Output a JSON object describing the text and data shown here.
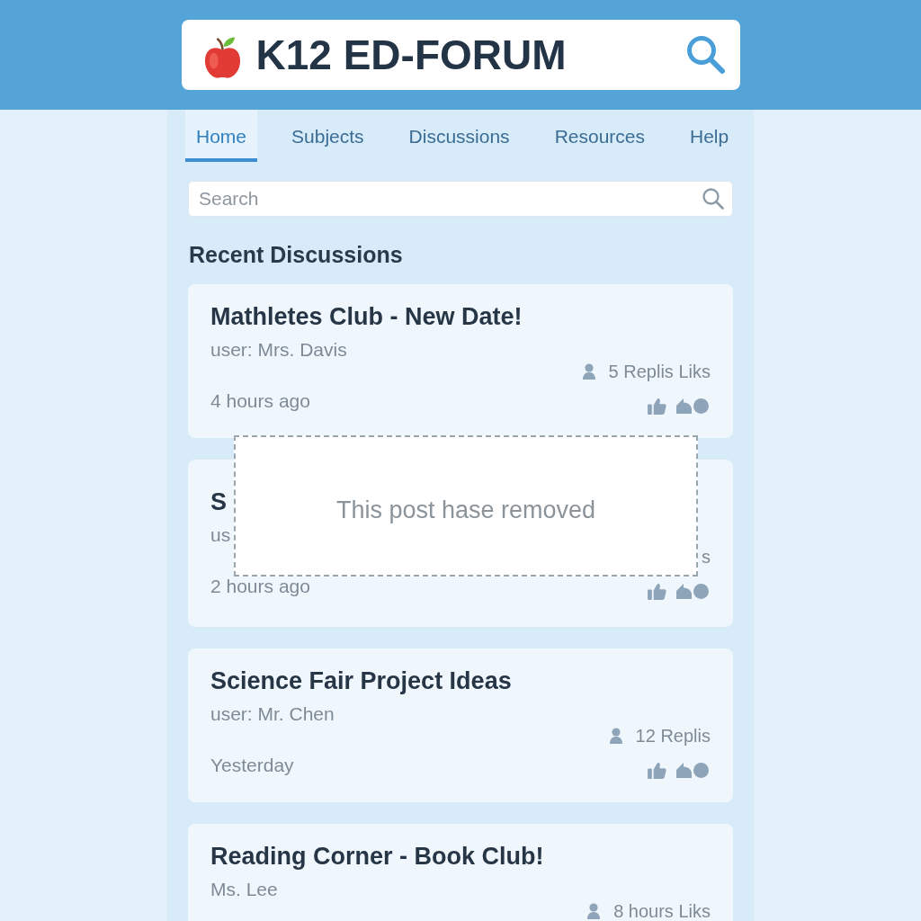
{
  "header": {
    "title": "K12 ED-FORUM"
  },
  "nav": {
    "tabs": [
      {
        "label": "Home",
        "selected": true
      },
      {
        "label": "Subjects",
        "selected": false
      },
      {
        "label": "Discussions",
        "selected": false
      },
      {
        "label": "Resources",
        "selected": false
      },
      {
        "label": "Help",
        "selected": false
      }
    ]
  },
  "search": {
    "placeholder": "Search"
  },
  "section_title": "Recent Discussions",
  "posts": [
    {
      "title": "Mathletes Club - New Date!",
      "author": "user: Mrs. Davis",
      "stats": "5 Replis Liks",
      "time": "4 hours ago",
      "actions": [
        {
          "kind": "like"
        },
        {
          "kind": "reply"
        }
      ]
    },
    {
      "title": "S",
      "author": "us",
      "stats": "s",
      "time": "2 hours ago",
      "actions": [
        {
          "kind": "like"
        },
        {
          "kind": "reply"
        }
      ],
      "removed_notice": "This post hase removed"
    },
    {
      "title": "Science Fair Project Ideas",
      "author": "user: Mr. Chen",
      "stats": "12 Replis",
      "time": "Yesterday",
      "actions": [
        {
          "kind": "like"
        },
        {
          "kind": "reply"
        }
      ]
    },
    {
      "title": "Reading Corner - Book Club!",
      "author": "Ms. Lee",
      "stats": "8 hours Liks"
    }
  ]
}
